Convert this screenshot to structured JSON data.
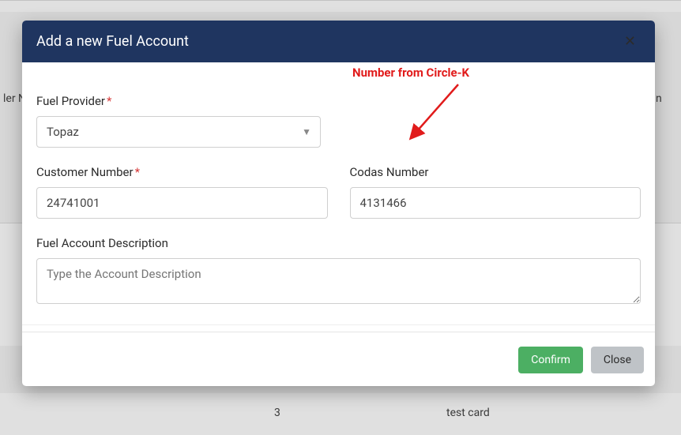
{
  "modal": {
    "title": "Add a new Fuel Account",
    "close_icon": "✕"
  },
  "annotation": {
    "note": "Number from Circle-K"
  },
  "fields": {
    "fuel_provider": {
      "label": "Fuel Provider",
      "value": "Topaz"
    },
    "customer_number": {
      "label": "Customer Number",
      "value": "24741001"
    },
    "codas_number": {
      "label": "Codas Number",
      "value": "4131466"
    },
    "description": {
      "label": "Fuel Account Description",
      "placeholder": "Type the Account Description"
    }
  },
  "footer": {
    "confirm": "Confirm",
    "close": "Close"
  },
  "background": {
    "col_left": "ler N",
    "col_right": "n",
    "cell_num": "3",
    "cell_desc": "test card"
  }
}
